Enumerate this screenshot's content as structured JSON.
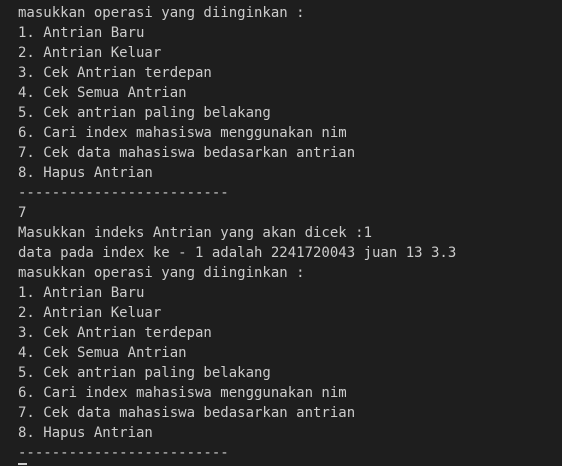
{
  "terminal": {
    "lines": [
      "masukkan operasi yang diinginkan :",
      "1. Antrian Baru",
      "2. Antrian Keluar",
      "3. Cek Antrian terdepan",
      "4. Cek Semua Antrian",
      "5. Cek antrian paling belakang",
      "6. Cari index mahasiswa menggunakan nim",
      "7. Cek data mahasiswa bedasarkan antrian",
      "8. Hapus Antrian",
      "-------------------------",
      "7",
      "Masukkan indeks Antrian yang akan dicek :1",
      "data pada index ke - 1 adalah 2241720043 juan 13 3.3",
      "masukkan operasi yang diinginkan :",
      "1. Antrian Baru",
      "2. Antrian Keluar",
      "3. Cek Antrian terdepan",
      "4. Cek Semua Antrian",
      "5. Cek antrian paling belakang",
      "6. Cari index mahasiswa menggunakan nim",
      "7. Cek data mahasiswa bedasarkan antrian",
      "8. Hapus Antrian",
      "-------------------------"
    ],
    "colors": {
      "background": "#1e1e1e",
      "foreground": "#cccccc"
    }
  }
}
